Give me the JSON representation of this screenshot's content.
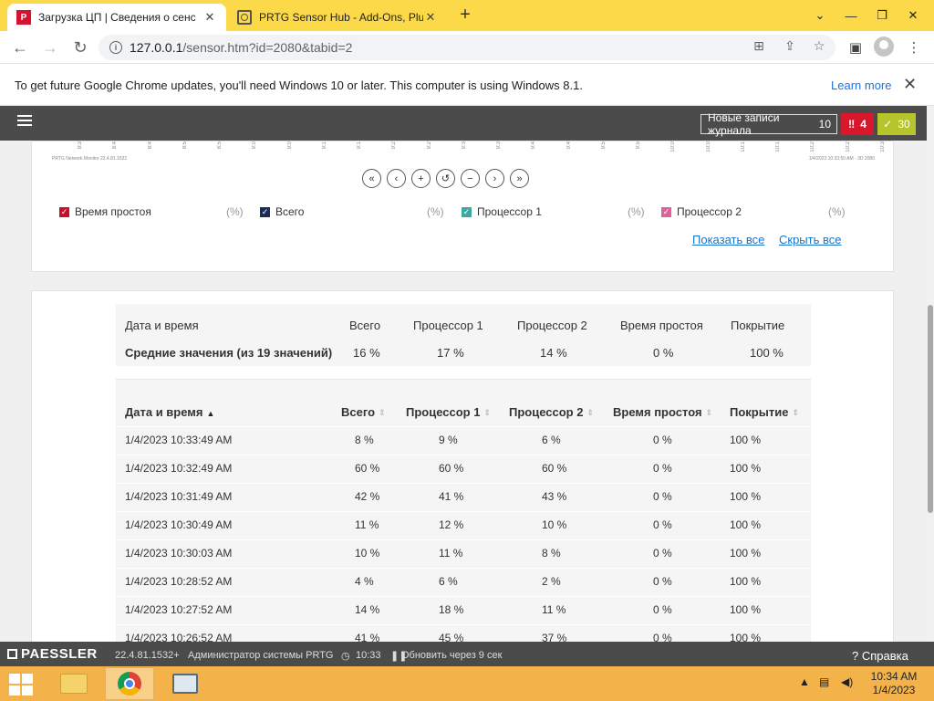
{
  "browser": {
    "tabs": [
      {
        "title": "Загрузка ЦП | Сведения о сенс",
        "active": true
      },
      {
        "title": "PRTG Sensor Hub - Add-Ons, Plu",
        "active": false
      }
    ],
    "url_host": "127.0.0.1",
    "url_path": "/sensor.htm?id=2080&tabid=2",
    "infobar_message": "To get future Google Chrome updates, you'll need Windows 10 or later. This computer is using Windows 8.1.",
    "infobar_link": "Learn more",
    "theme_color": "#fcd949"
  },
  "prtg_header": {
    "log_label": "Новые записи журнала",
    "log_count": "10",
    "alarm_count": "4",
    "ok_count": "30",
    "alarm_color": "#d7172b",
    "ok_color": "#b6c52a"
  },
  "graph": {
    "tick_labels": [
      "8:3",
      "8:4",
      "8:4",
      "8:5",
      "8:5",
      "9:0",
      "9:0",
      "9:1",
      "9:1",
      "9:2",
      "9:2",
      "9:3",
      "9:3",
      "9:4",
      "9:4",
      "9:5",
      "9:5",
      "10:0",
      "10:0",
      "10:1",
      "10:1",
      "10:2",
      "10:2",
      "10:3"
    ],
    "footer_left": "PRTG Network Monitor 22.4.81.1532",
    "footer_right": "1/4/2023 10:33:50 AM - 3D 2080",
    "zoom_buttons": [
      "«",
      "‹",
      "+",
      "↺",
      "−",
      "›",
      "»"
    ],
    "legend": [
      {
        "label": "Время простоя",
        "unit": "(%)",
        "color": "#c8102e"
      },
      {
        "label": "Всего",
        "unit": "(%)",
        "color": "#1d2a5c"
      },
      {
        "label": "Процессор 1",
        "unit": "(%)",
        "color": "#3aa99f"
      },
      {
        "label": "Процессор 2",
        "unit": "(%)",
        "color": "#e0609a"
      }
    ],
    "show_all": "Показать все",
    "hide_all": "Скрыть все"
  },
  "summary": {
    "headers": [
      "Дата и время",
      "Всего",
      "Процессор 1",
      "Процессор 2",
      "Время простоя",
      "Покрытие"
    ],
    "avg_label": "Средние значения (из 19 значений)",
    "avg_values": [
      "16 %",
      "17 %",
      "14 %",
      "0 %",
      "100 %"
    ]
  },
  "table": {
    "headers": [
      "Дата и время",
      "Всего",
      "Процессор 1",
      "Процессор 2",
      "Время простоя",
      "Покрытие"
    ],
    "rows": [
      [
        "1/4/2023 10:33:49 AM",
        "8 %",
        "9 %",
        "6 %",
        "0 %",
        "100 %"
      ],
      [
        "1/4/2023 10:32:49 AM",
        "60 %",
        "60 %",
        "60 %",
        "0 %",
        "100 %"
      ],
      [
        "1/4/2023 10:31:49 AM",
        "42 %",
        "41 %",
        "43 %",
        "0 %",
        "100 %"
      ],
      [
        "1/4/2023 10:30:49 AM",
        "11 %",
        "12 %",
        "10 %",
        "0 %",
        "100 %"
      ],
      [
        "1/4/2023 10:30:03 AM",
        "10 %",
        "11 %",
        "8 %",
        "0 %",
        "100 %"
      ],
      [
        "1/4/2023 10:28:52 AM",
        "4 %",
        "6 %",
        "2 %",
        "0 %",
        "100 %"
      ],
      [
        "1/4/2023 10:27:52 AM",
        "14 %",
        "18 %",
        "11 %",
        "0 %",
        "100 %"
      ],
      [
        "1/4/2023 10:26:52 AM",
        "41 %",
        "45 %",
        "37 %",
        "0 %",
        "100 %"
      ]
    ]
  },
  "prtg_footer": {
    "brand": "PAESSLER",
    "version": "22.4.81.1532+",
    "user": "Администратор системы PRTG",
    "time": "10:33",
    "refresh": "Обновить через 9 сек",
    "help": "Справка"
  },
  "taskbar": {
    "clock_time": "10:34 AM",
    "clock_date": "1/4/2023"
  }
}
